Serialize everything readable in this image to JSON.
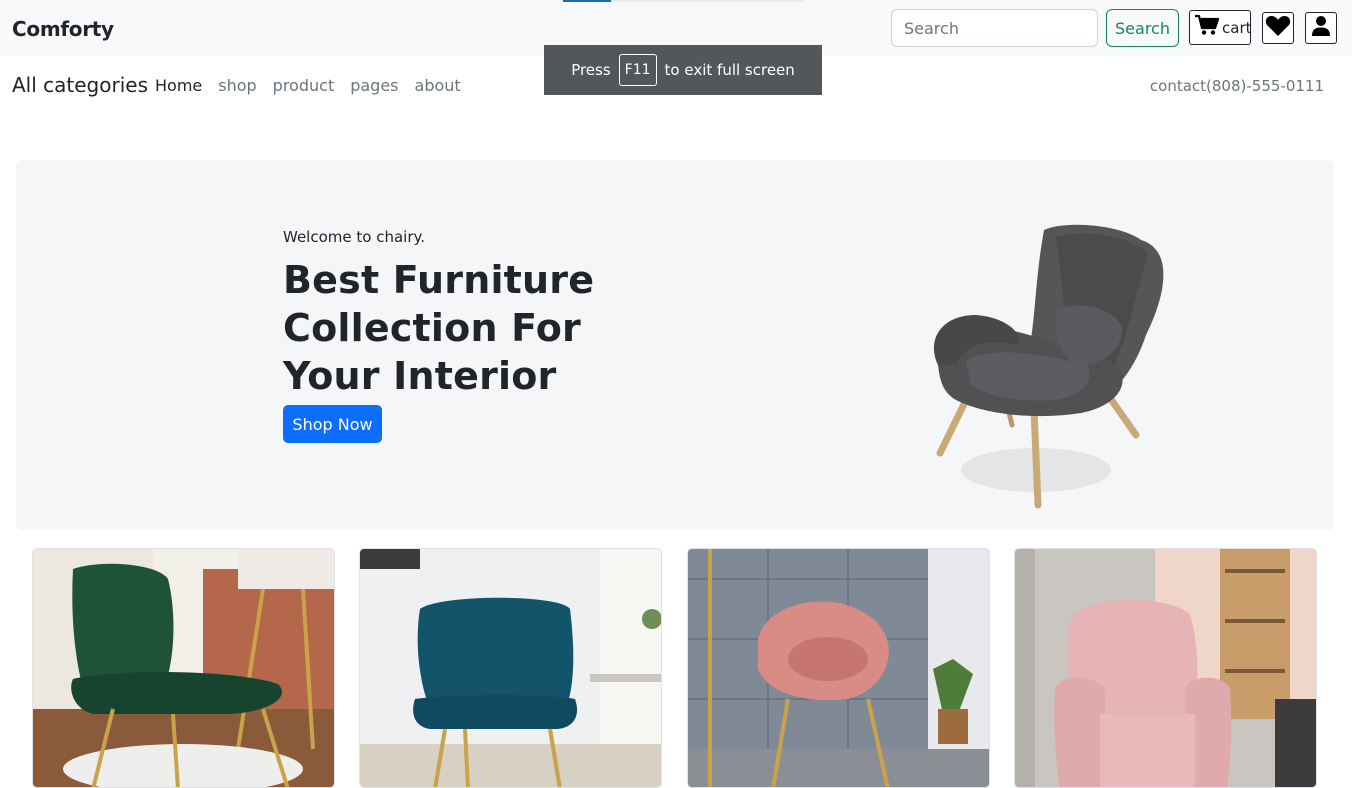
{
  "brand": {
    "name": "Comforty"
  },
  "search": {
    "placeholder": "Search",
    "button_label": "Search"
  },
  "cart": {
    "label": "cart"
  },
  "icons": {
    "cart": "cart-icon",
    "heart": "heart-icon",
    "user": "user-icon"
  },
  "subnav": {
    "all_categories": "All categories",
    "links": [
      {
        "label": "Home",
        "active": true
      },
      {
        "label": "shop",
        "active": false
      },
      {
        "label": "product",
        "active": false
      },
      {
        "label": "pages",
        "active": false
      },
      {
        "label": "about",
        "active": false
      }
    ],
    "contact": "contact(808)-555-0111"
  },
  "fullscreen_toast": {
    "prefix": "Press",
    "key": "F11",
    "suffix": "to exit full screen"
  },
  "hero": {
    "kicker": "Welcome to chairy.",
    "title": "Best Furniture Collection For Your Interior",
    "cta": "Shop Now"
  },
  "colors": {
    "accent_green": "#198754",
    "primary_blue": "#0d6efd",
    "hero_bg": "#f5f6f8",
    "navbar_bg": "#f8f9fa"
  },
  "products": [
    {
      "name": "green-velvet-chair"
    },
    {
      "name": "teal-velvet-armchair"
    },
    {
      "name": "pink-round-chair"
    },
    {
      "name": "pink-wingback-armchair"
    }
  ]
}
